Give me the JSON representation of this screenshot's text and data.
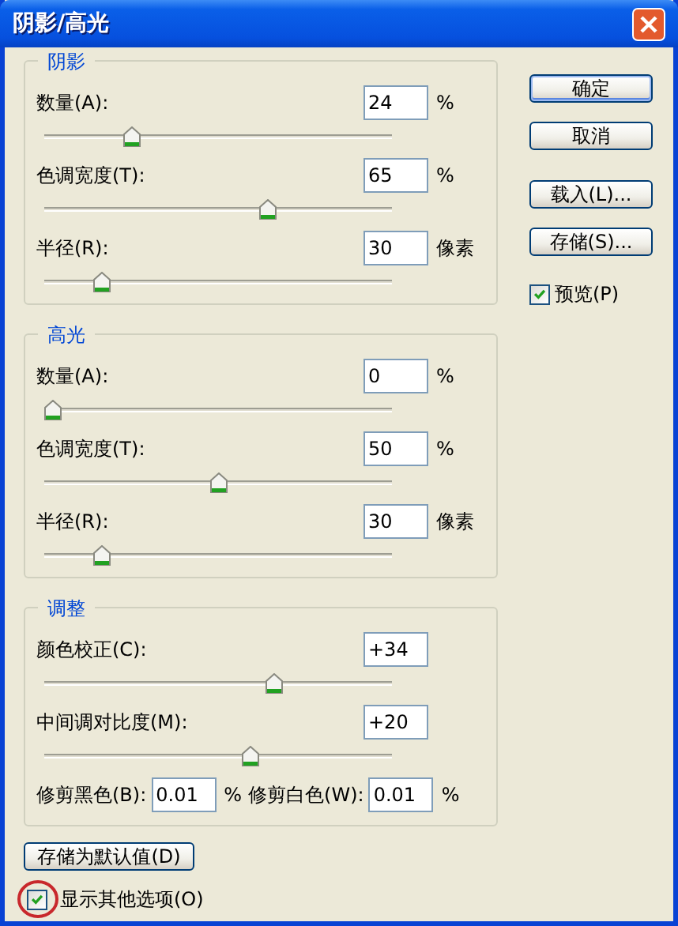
{
  "window": {
    "title": "阴影/高光"
  },
  "groups": [
    {
      "title": "阴影",
      "rows": [
        {
          "kind": "slider",
          "label": "数量(A):",
          "value": "24",
          "unit": "%",
          "level": 0.24
        },
        {
          "kind": "slider",
          "label": "色调宽度(T):",
          "value": "65",
          "unit": "%",
          "level": 0.65
        },
        {
          "kind": "slider",
          "label": "半径(R):",
          "value": "30",
          "unit": "像素",
          "level": 0.15
        }
      ]
    },
    {
      "title": "高光",
      "rows": [
        {
          "kind": "slider",
          "label": "数量(A):",
          "value": "0",
          "unit": "%",
          "level": 0
        },
        {
          "kind": "slider",
          "label": "色调宽度(T):",
          "value": "50",
          "unit": "%",
          "level": 0.5
        },
        {
          "kind": "slider",
          "label": "半径(R):",
          "value": "30",
          "unit": "像素",
          "level": 0.15
        }
      ]
    },
    {
      "title": "调整",
      "rows": [
        {
          "kind": "slider",
          "label": "颜色校正(C):",
          "value": "+34",
          "level": 0.67
        },
        {
          "kind": "slider",
          "label": "中间调对比度(M):",
          "value": "+20",
          "level": 0.6
        },
        {
          "kind": "pair",
          "fields": [
            {
              "label": "修剪黑色(B):",
              "value": "0.01",
              "unit": "%"
            },
            {
              "label": "修剪白色(W):",
              "value": "0.01",
              "unit": "%"
            }
          ]
        }
      ]
    }
  ],
  "buttons": [
    {
      "label": "确定",
      "default": true
    },
    {
      "label": "取消",
      "default": false
    },
    {
      "label": "载入(L)...",
      "default": false
    },
    {
      "label": "存储(S)...",
      "default": false
    }
  ],
  "preview": {
    "label": "预览(P)",
    "checked": true
  },
  "save_default_button": "存储为默认值(D)",
  "more_options": {
    "label": "显示其他选项(O)",
    "checked": true,
    "circled": true
  }
}
